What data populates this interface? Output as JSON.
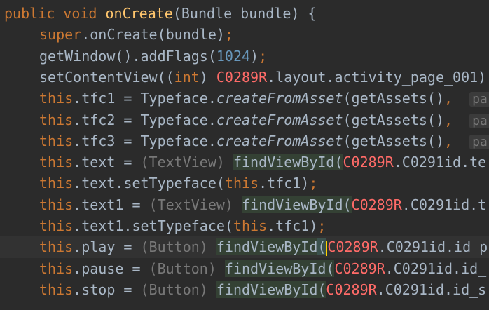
{
  "editor": {
    "colors": {
      "background": "#2b2b2b",
      "keyword": "#cc7832",
      "method": "#ffc66d",
      "number": "#6897bb",
      "class_ref": "#ff6b68",
      "plain": "#a9b7c6",
      "muted": "#787878",
      "usage_highlight": "#344134"
    },
    "lines": [
      {
        "tokens": [
          {
            "text": "public void ",
            "type": "kw"
          },
          {
            "text": "onCreate",
            "type": "fn"
          },
          {
            "text": "(Bundle bundle) {",
            "type": "txt"
          }
        ]
      },
      {
        "tokens": [
          {
            "text": "super",
            "type": "kw"
          },
          {
            "text": ".onCreate(bundle)",
            "type": "txt"
          },
          {
            "text": ";",
            "type": "kw"
          }
        ]
      },
      {
        "tokens": [
          {
            "text": "getWindow().addFlags(",
            "type": "txt"
          },
          {
            "text": "1024",
            "type": "num"
          },
          {
            "text": ")",
            "type": "txt"
          },
          {
            "text": ";",
            "type": "kw"
          }
        ]
      },
      {
        "tokens": [
          {
            "text": "setContentView((",
            "type": "txt"
          },
          {
            "text": "int",
            "type": "kw"
          },
          {
            "text": ") ",
            "type": "txt"
          },
          {
            "text": "C0289R",
            "type": "cls"
          },
          {
            "text": ".layout.activity_page_001)",
            "type": "txt"
          }
        ]
      },
      {
        "tokens": [
          {
            "text": "this",
            "type": "kw"
          },
          {
            "text": ".tfc1 = Typeface.",
            "type": "txt"
          },
          {
            "text": "createFromAsset",
            "type": "ital"
          },
          {
            "text": "(getAssets()",
            "type": "txt"
          },
          {
            "text": ",  ",
            "type": "kw"
          },
          {
            "text": "pa",
            "type": "hint"
          }
        ]
      },
      {
        "tokens": [
          {
            "text": "this",
            "type": "kw"
          },
          {
            "text": ".tfc2 = Typeface.",
            "type": "txt"
          },
          {
            "text": "createFromAsset",
            "type": "ital"
          },
          {
            "text": "(getAssets()",
            "type": "txt"
          },
          {
            "text": ",  ",
            "type": "kw"
          },
          {
            "text": "pa",
            "type": "hint"
          }
        ]
      },
      {
        "tokens": [
          {
            "text": "this",
            "type": "kw"
          },
          {
            "text": ".tfc3 = Typeface.",
            "type": "txt"
          },
          {
            "text": "createFromAsset",
            "type": "ital"
          },
          {
            "text": "(getAssets()",
            "type": "txt"
          },
          {
            "text": ",  ",
            "type": "kw"
          },
          {
            "text": "pa",
            "type": "hint"
          }
        ]
      },
      {
        "tokens": [
          {
            "text": "this",
            "type": "kw"
          },
          {
            "text": ".text = ",
            "type": "txt"
          },
          {
            "text": "(TextView) ",
            "type": "dim"
          },
          {
            "text": "findViewById(",
            "type": "hl"
          },
          {
            "text": "C0289R",
            "type": "cls"
          },
          {
            "text": ".C0291id.te",
            "type": "txt"
          }
        ]
      },
      {
        "tokens": [
          {
            "text": "this",
            "type": "kw"
          },
          {
            "text": ".text.setTypeface(",
            "type": "txt"
          },
          {
            "text": "this",
            "type": "kw"
          },
          {
            "text": ".tfc1)",
            "type": "txt"
          },
          {
            "text": ";",
            "type": "kw"
          }
        ]
      },
      {
        "tokens": [
          {
            "text": "this",
            "type": "kw"
          },
          {
            "text": ".text1 = ",
            "type": "txt"
          },
          {
            "text": "(TextView) ",
            "type": "dim"
          },
          {
            "text": "findViewById(",
            "type": "hl"
          },
          {
            "text": "C0289R",
            "type": "cls"
          },
          {
            "text": ".C0291id.t",
            "type": "txt"
          }
        ]
      },
      {
        "tokens": [
          {
            "text": "this",
            "type": "kw"
          },
          {
            "text": ".text1.setTypeface(",
            "type": "txt"
          },
          {
            "text": "this",
            "type": "kw"
          },
          {
            "text": ".tfc1)",
            "type": "txt"
          },
          {
            "text": ";",
            "type": "kw"
          }
        ]
      },
      {
        "current": true,
        "tokens": [
          {
            "text": "this",
            "type": "kw"
          },
          {
            "text": ".play = ",
            "type": "txt"
          },
          {
            "text": "(Button) ",
            "type": "dim"
          },
          {
            "text": "findViewById",
            "type": "hl"
          },
          {
            "text": "(",
            "type": "brace"
          },
          {
            "text": "",
            "type": "caret"
          },
          {
            "text": "C0289R",
            "type": "cls"
          },
          {
            "text": ".C0291id.id_p",
            "type": "txt"
          }
        ]
      },
      {
        "tokens": [
          {
            "text": "this",
            "type": "kw"
          },
          {
            "text": ".pause = ",
            "type": "txt"
          },
          {
            "text": "(Button) ",
            "type": "dim"
          },
          {
            "text": "findViewById(",
            "type": "hl"
          },
          {
            "text": "C0289R",
            "type": "cls"
          },
          {
            "text": ".C0291id.id_",
            "type": "txt"
          }
        ]
      },
      {
        "tokens": [
          {
            "text": "this",
            "type": "kw"
          },
          {
            "text": ".stop = ",
            "type": "txt"
          },
          {
            "text": "(Button) ",
            "type": "dim"
          },
          {
            "text": "findViewById(",
            "type": "hl"
          },
          {
            "text": "C0289R",
            "type": "cls"
          },
          {
            "text": ".C0291id.id_s",
            "type": "txt"
          }
        ]
      }
    ]
  }
}
